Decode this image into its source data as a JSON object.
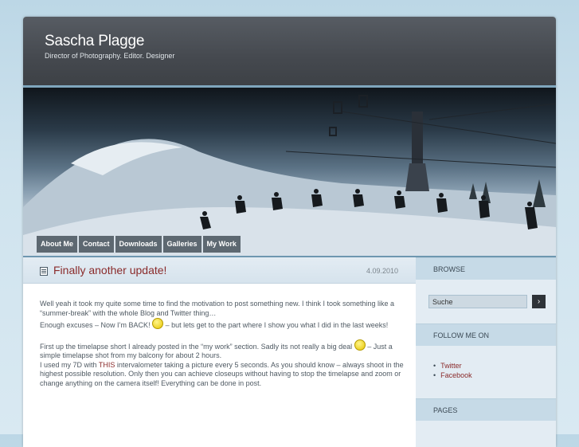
{
  "header": {
    "title": "Sascha Plagge",
    "description": "Director of Photography. Editor. Designer"
  },
  "nav": [
    "About Me",
    "Contact",
    "Downloads",
    "Galleries",
    "My Work"
  ],
  "post": {
    "title": "Finally another update!",
    "date": "4.09.2010",
    "p1": "Well yeah it took my quite some time to find the motivation to post something new. I think I took something like a “summer-break” with the whole Blog and Twitter thing…",
    "p2a": "Enough excuses – Now I’m BACK!",
    "p2b": "– but lets get to the part where I show you what I did in the last weeks!",
    "p3a": "First up the timelapse short I already posted in the “my work” section. Sadly its not really a big deal",
    "p3b": "– Just a simple timelapse shot from my balcony for about 2 hours.",
    "p4a": "I used my 7D with",
    "p4_link": "THIS",
    "p4b": "intervalometer taking a picture every 5 seconds. As you should know – always shoot in the highest possible resolution. Only then you can achieve closeups without having to stop the timelapse and zoom or change anything on the camera itself! Everything can be done in post."
  },
  "sidebar": {
    "browse_heading": "BROWSE",
    "search_value": "Suche",
    "search_button": "›",
    "follow_heading": "FOLLOW ME ON",
    "follow_links": [
      "Twitter",
      "Facebook"
    ],
    "pages_heading": "PAGES"
  },
  "colors": {
    "accent": "#8a2b2b",
    "header_bg": "#4a4e54"
  }
}
